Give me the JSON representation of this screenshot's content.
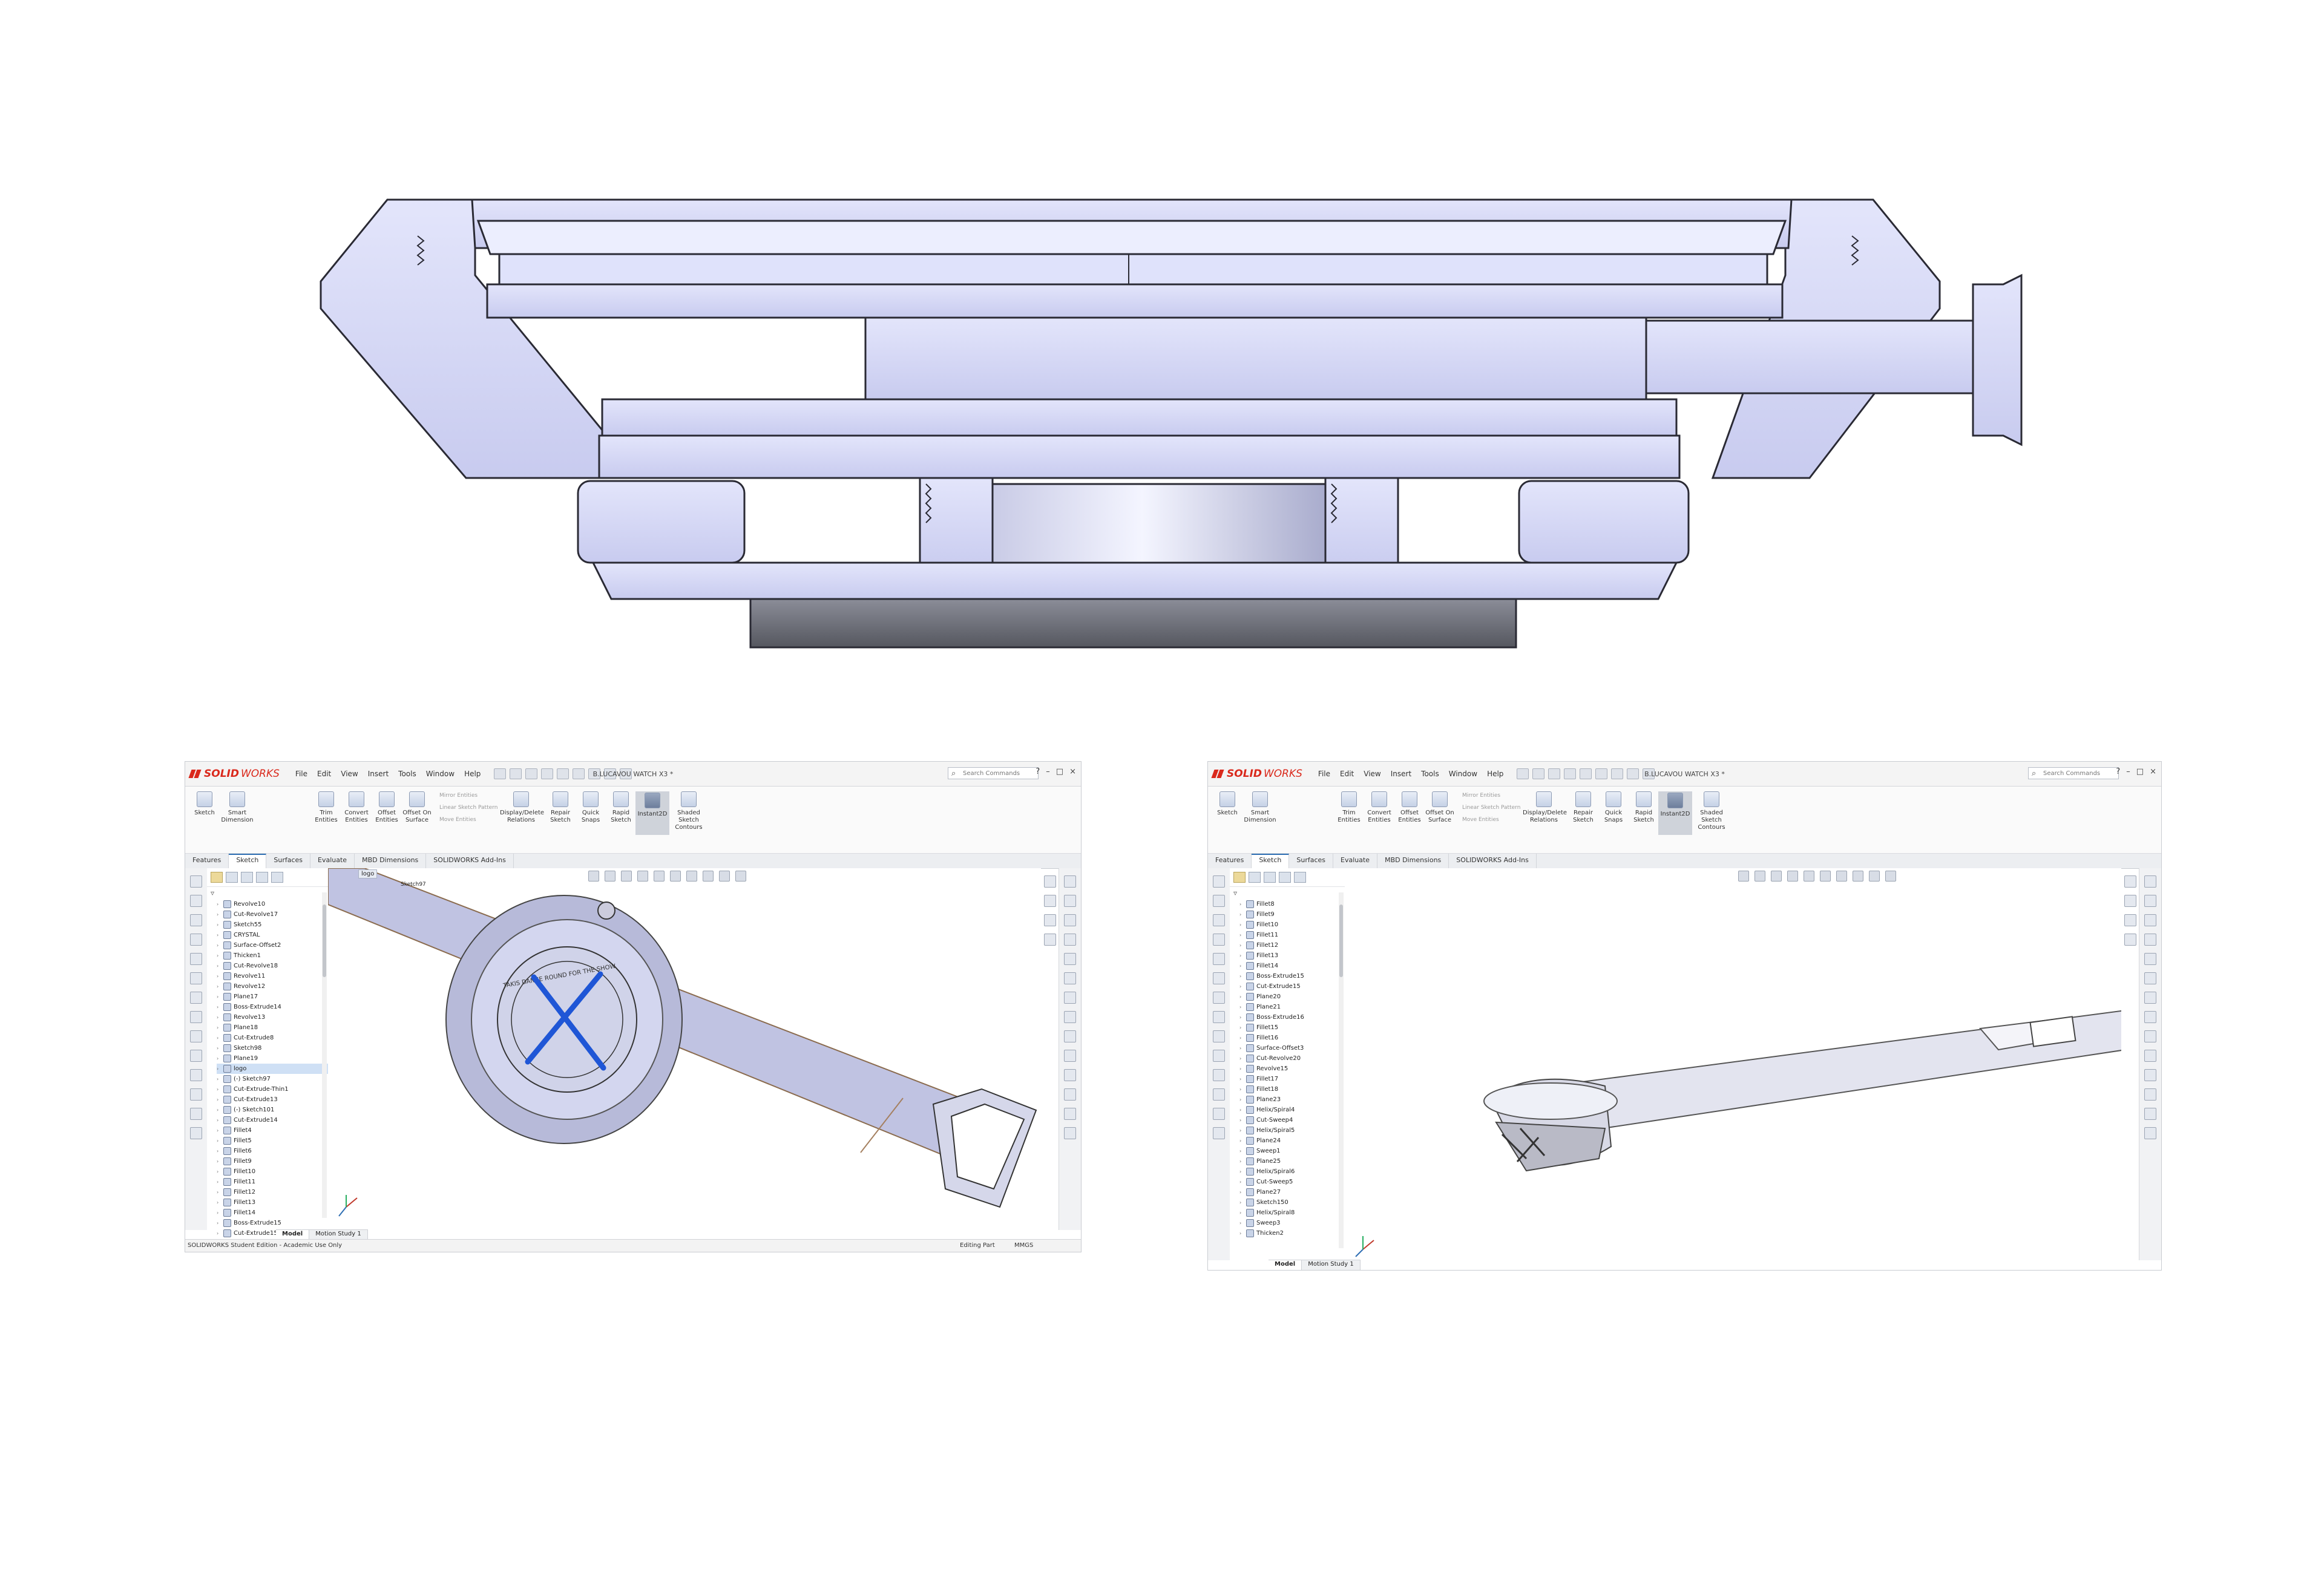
{
  "left_window": {
    "title": "B.LUCAVOU WATCH X3 *",
    "logo": {
      "ds": "3S",
      "solid": "SOLID",
      "works": "WORKS"
    },
    "menus": [
      "File",
      "Edit",
      "View",
      "Insert",
      "Tools",
      "Window",
      "Help"
    ],
    "search_placeholder": "Search Commands",
    "window_controls": [
      "?",
      "–",
      "□",
      "×"
    ],
    "ribbon": {
      "sketch": "Sketch",
      "smart_dimension": "Smart Dimension",
      "trim_entities": "Trim Entities",
      "convert_entities": "Convert Entities",
      "offset_entities": "Offset Entities",
      "offset_on_surface": "Offset On Surface",
      "mirror_entities": "Mirror Entities",
      "linear_sketch_pattern": "Linear Sketch Pattern",
      "move_entities": "Move Entities",
      "display_delete_relations": "Display/Delete Relations",
      "repair_sketch": "Repair Sketch",
      "quick_snaps": "Quick Snaps",
      "rapid_sketch": "Rapid Sketch",
      "instant2d": "Instant2D",
      "shaded_sketch_contours": "Shaded Sketch Contours"
    },
    "tabs": [
      "Features",
      "Sketch",
      "Surfaces",
      "Evaluate",
      "MBD Dimensions",
      "SOLIDWORKS Add-Ins"
    ],
    "active_tab": "Sketch",
    "tree": [
      "Revolve10",
      "Cut-Revolve17",
      "Sketch55",
      "CRYSTAL",
      "Surface-Offset2",
      "Thicken1",
      "Cut-Revolve18",
      "Revolve11",
      "Revolve12",
      "Plane17",
      "Boss-Extrude14",
      "Revolve13",
      "Plane18",
      "Cut-Extrude8",
      "Sketch98",
      "Plane19",
      "logo",
      "(-) Sketch97",
      "Cut-Extrude-Thin1",
      "Cut-Extrude13",
      "(-) Sketch101",
      "Cut-Extrude14",
      "Fillet4",
      "Fillet5",
      "Fillet6",
      "Fillet9",
      "Fillet10",
      "Fillet11",
      "Fillet12",
      "Fillet13",
      "Fillet14",
      "Boss-Extrude15",
      "Cut-Extrude15"
    ],
    "selected_item": "logo",
    "context_tag": "logo",
    "context_sub": "Sketch97",
    "bottom_tabs": [
      "Model",
      "Motion Study 1"
    ],
    "status_left": "SOLIDWORKS Student Edition - Academic Use Only",
    "status_mid": "Editing Part",
    "status_units": "MMGS",
    "dial_text": "TAKIS DANCE ROUND FOR THE SHOW"
  },
  "right_window": {
    "title": "B.LUCAVOU WATCH X3 *",
    "logo": {
      "ds": "3S",
      "solid": "SOLID",
      "works": "WORKS"
    },
    "menus": [
      "File",
      "Edit",
      "View",
      "Insert",
      "Tools",
      "Window",
      "Help"
    ],
    "search_placeholder": "Search Commands",
    "window_controls": [
      "?",
      "–",
      "□",
      "×"
    ],
    "tabs": [
      "Features",
      "Sketch",
      "Surfaces",
      "Evaluate",
      "MBD Dimensions",
      "SOLIDWORKS Add-Ins"
    ],
    "active_tab": "Sketch",
    "tree": [
      "Fillet8",
      "Fillet9",
      "Fillet10",
      "Fillet11",
      "Fillet12",
      "Fillet13",
      "Fillet14",
      "Boss-Extrude15",
      "Cut-Extrude15",
      "Plane20",
      "Plane21",
      "Boss-Extrude16",
      "Fillet15",
      "Fillet16",
      "Surface-Offset3",
      "Cut-Revolve20",
      "Revolve15",
      "Fillet17",
      "Fillet18",
      "Plane23",
      "Helix/Spiral4",
      "Cut-Sweep4",
      "Helix/Spiral5",
      "Plane24",
      "Sweep1",
      "Plane25",
      "Helix/Spiral6",
      "Cut-Sweep5",
      "Plane27",
      "Sketch150",
      "Helix/Spiral8",
      "Sweep3",
      "Thicken2"
    ],
    "bottom_tabs": [
      "Model",
      "Motion Study 1"
    ]
  },
  "colors": {
    "part_fill": "#d9dcf5",
    "part_fill_dark": "#a8acd6",
    "strap_fill": "#c3c6e6",
    "case_bottom": "#6d6f7a",
    "edge": "#2a2a34",
    "accent_blue": "#2f6fb3",
    "logo_red": "#da291c",
    "sketch_blue": "#1f56d6"
  }
}
